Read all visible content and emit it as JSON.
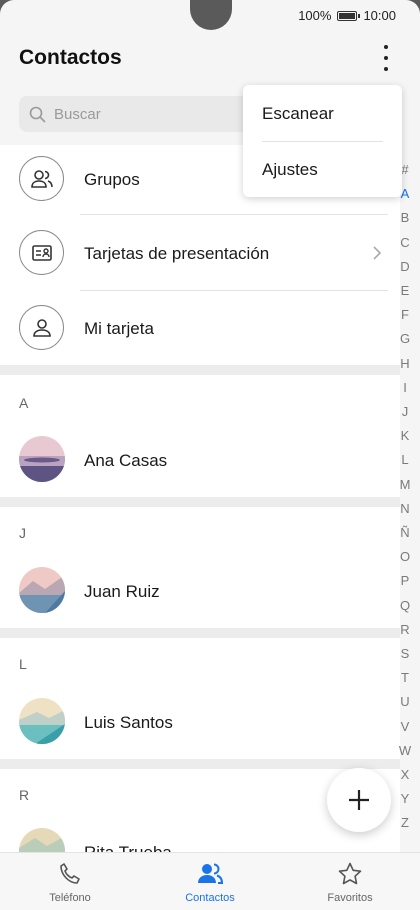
{
  "status": {
    "battery": "100%",
    "time": "10:00"
  },
  "header": {
    "title": "Contactos"
  },
  "search": {
    "placeholder": "Buscar"
  },
  "overflow_menu": {
    "items": [
      "Escanear",
      "Ajustes"
    ]
  },
  "top_items": [
    {
      "label": "Grupos",
      "icon": "people-icon"
    },
    {
      "label": "Tarjetas de presentación",
      "icon": "business-card-icon"
    },
    {
      "label": "Mi tarjeta",
      "icon": "person-icon"
    }
  ],
  "sections": [
    {
      "letter": "A",
      "contacts": [
        "Ana Casas"
      ]
    },
    {
      "letter": "J",
      "contacts": [
        "Juan Ruiz"
      ]
    },
    {
      "letter": "L",
      "contacts": [
        "Luis Santos"
      ]
    },
    {
      "letter": "R",
      "contacts": [
        "Rita Trueba"
      ]
    }
  ],
  "alphabet": [
    "#",
    "A",
    "B",
    "C",
    "D",
    "E",
    "F",
    "G",
    "H",
    "I",
    "J",
    "K",
    "L",
    "M",
    "N",
    "Ñ",
    "O",
    "P",
    "Q",
    "R",
    "S",
    "T",
    "U",
    "V",
    "W",
    "X",
    "Y",
    "Z"
  ],
  "alphabet_active": "A",
  "bottom_nav": [
    {
      "label": "Teléfono",
      "icon": "phone-icon"
    },
    {
      "label": "Contactos",
      "icon": "contacts-icon",
      "active": true
    },
    {
      "label": "Favoritos",
      "icon": "star-icon"
    }
  ],
  "colors": {
    "accent": "#1a73e8",
    "background": "#f5f5f5"
  }
}
